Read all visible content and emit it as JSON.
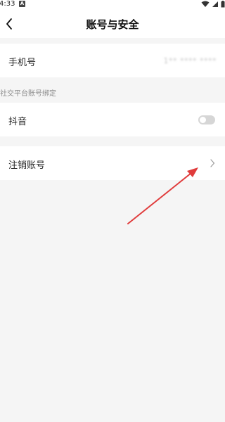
{
  "status_bar": {
    "time": "4:33",
    "notification_icon": "A",
    "icons": [
      "wifi-icon",
      "signal-icon",
      "battery-icon"
    ]
  },
  "header": {
    "title": "账号与安全",
    "back_icon": "chevron-left-icon"
  },
  "account": {
    "phone_label": "手机号",
    "phone_value": "1** **** ****"
  },
  "social_section": {
    "label": "社交平台账号绑定",
    "douyin_label": "抖音",
    "douyin_bound": false
  },
  "cancel_account": {
    "label": "注销账号",
    "chevron_icon": "chevron-right-icon"
  },
  "annotation": {
    "color": "#e03c3c",
    "shape": "red-arrow-pointing-to-chevron"
  }
}
